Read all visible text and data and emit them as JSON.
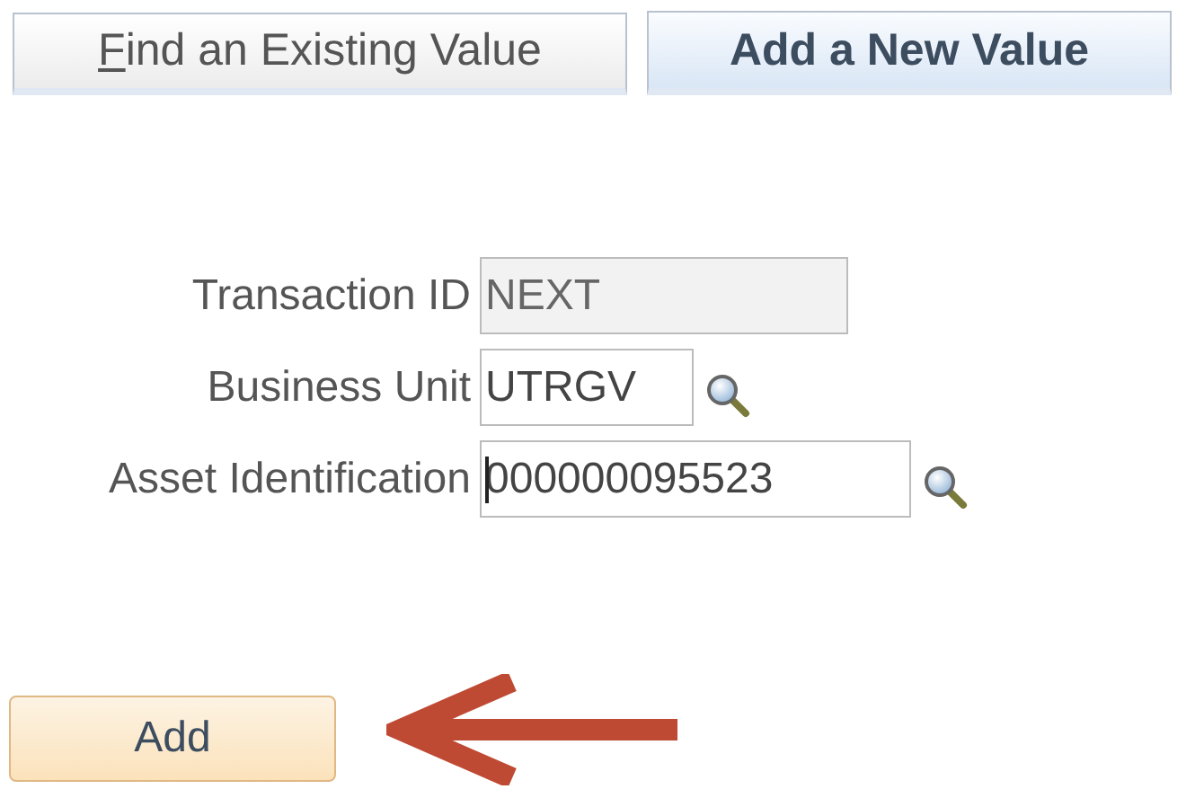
{
  "tabs": [
    {
      "label": "Find an Existing Value",
      "access_key_underlined": true,
      "selected": false
    },
    {
      "label": "Add a New Value",
      "selected": true
    }
  ],
  "fields": [
    {
      "label": "Transaction ID",
      "value": "NEXT",
      "disabled": true,
      "lookup": false,
      "focused": false
    },
    {
      "label": "Business Unit",
      "value": "UTRGV",
      "disabled": false,
      "lookup": true,
      "focused": false
    },
    {
      "label": "Asset Identification",
      "value": "000000095523",
      "disabled": false,
      "lookup": true,
      "focused": true
    }
  ],
  "buttons": [
    {
      "label": "Add"
    }
  ],
  "annotation": {
    "kind": "arrow"
  }
}
